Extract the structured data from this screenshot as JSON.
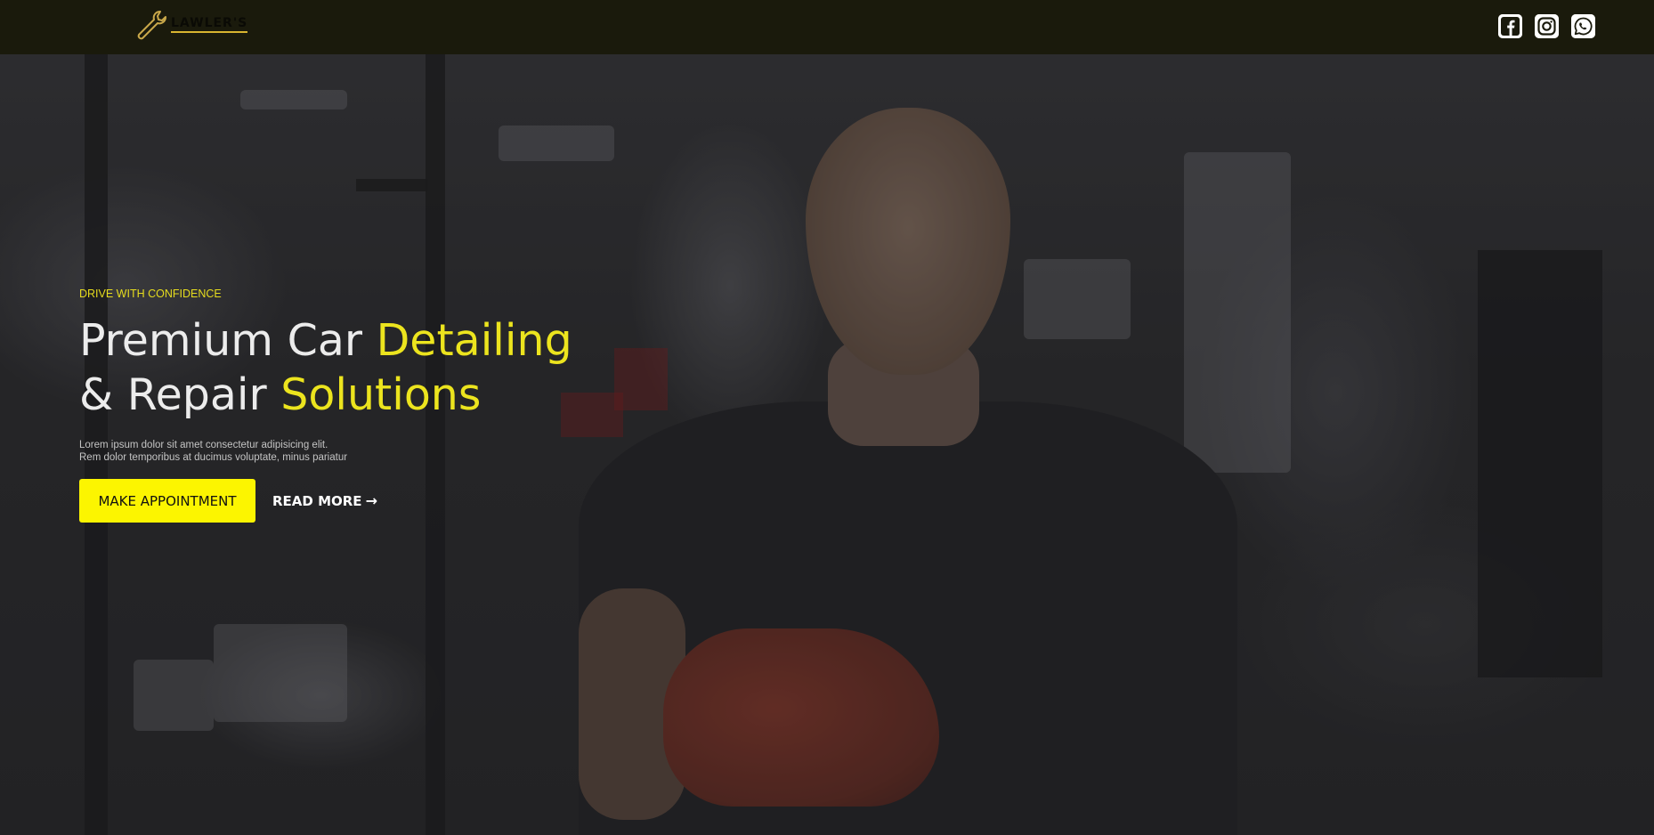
{
  "header": {
    "logo_text": "LAWLER'S",
    "logo_icon": "wrench-icon",
    "social": [
      {
        "name": "facebook",
        "icon": "facebook-icon"
      },
      {
        "name": "instagram",
        "icon": "instagram-icon"
      },
      {
        "name": "whatsapp",
        "icon": "whatsapp-icon"
      }
    ]
  },
  "hero": {
    "eyebrow": "DRIVE WITH CONFIDENCE",
    "headline_part1": "Premium Car ",
    "headline_highlight1": "Detailing",
    "headline_part2": "& Repair ",
    "headline_highlight2": "Solutions",
    "description_line1": "Lorem ipsum dolor sit amet consectetur adipisicing elit.",
    "description_line2": "Rem dolor temporibus at ducimus voluptate, minus pariatur",
    "primary_button": "MAKE APPOINTMENT",
    "secondary_button": "READ MORE",
    "secondary_icon": "arrow-right-icon"
  },
  "colors": {
    "accent": "#FCF500",
    "highlight_text": "#ECE41E",
    "header_bg": "#1A1A0C"
  }
}
